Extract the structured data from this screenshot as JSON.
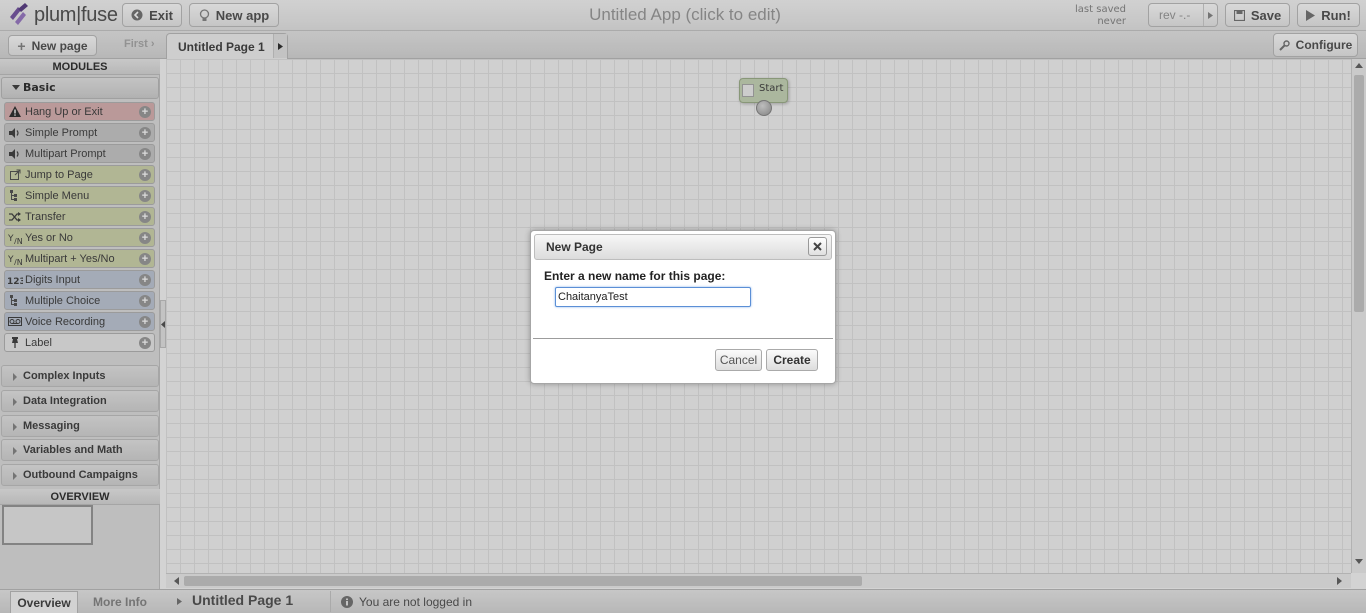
{
  "header": {
    "logo_text": "plum|fuse",
    "exit_label": "Exit",
    "new_app_label": "New app",
    "app_title": "Untitled App (click to edit)",
    "last_saved_label": "last saved",
    "last_saved_value": "never",
    "rev_label": "rev -.-",
    "save_label": "Save",
    "run_label": "Run!"
  },
  "pagebar": {
    "new_page_label": "New page",
    "first_label": "First",
    "current_tab": "Untitled Page 1",
    "configure_label": "Configure"
  },
  "sidebar": {
    "modules_header": "MODULES",
    "basic_label": "Basic",
    "modules": [
      {
        "label": "Hang Up or Exit",
        "icon": "warning-icon",
        "color": "#d9b3b3"
      },
      {
        "label": "Simple Prompt",
        "icon": "speaker-icon",
        "color": "#c9c9c9"
      },
      {
        "label": "Multipart Prompt",
        "icon": "speaker-icon",
        "color": "#c9c9c9"
      },
      {
        "label": "Jump to Page",
        "icon": "external-link-icon",
        "color": "#cfd4ad"
      },
      {
        "label": "Simple Menu",
        "icon": "menu-tree-icon",
        "color": "#cfd4ad"
      },
      {
        "label": "Transfer",
        "icon": "shuffle-icon",
        "color": "#cfd4ad"
      },
      {
        "label": "Yes or No",
        "icon": "yes-no-icon",
        "color": "#cfd4ad"
      },
      {
        "label": "Multipart + Yes/No",
        "icon": "yes-no-icon",
        "color": "#cfd4ad"
      },
      {
        "label": "Digits Input",
        "icon": "digits-icon",
        "color": "#bfc8d6"
      },
      {
        "label": "Multiple Choice",
        "icon": "menu-tree-icon",
        "color": "#bfc8d6"
      },
      {
        "label": "Voice Recording",
        "icon": "voicemail-icon",
        "color": "#bfc8d6"
      },
      {
        "label": "Label",
        "icon": "pin-icon",
        "color": "#e9e9e9"
      }
    ],
    "categories": [
      "Complex Inputs",
      "Data Integration",
      "Messaging",
      "Variables and Math",
      "Outbound Campaigns"
    ],
    "overview_header": "OVERVIEW"
  },
  "canvas": {
    "start_label": "Start"
  },
  "dialog": {
    "title": "New Page",
    "prompt": "Enter a new name for this page:",
    "input_value": "ChaitanyaTest",
    "cancel_label": "Cancel",
    "create_label": "Create"
  },
  "statusbar": {
    "overview_tab": "Overview",
    "more_info_tab": "More Info",
    "page_name": "Untitled Page 1",
    "login_status": "You are not logged in"
  }
}
